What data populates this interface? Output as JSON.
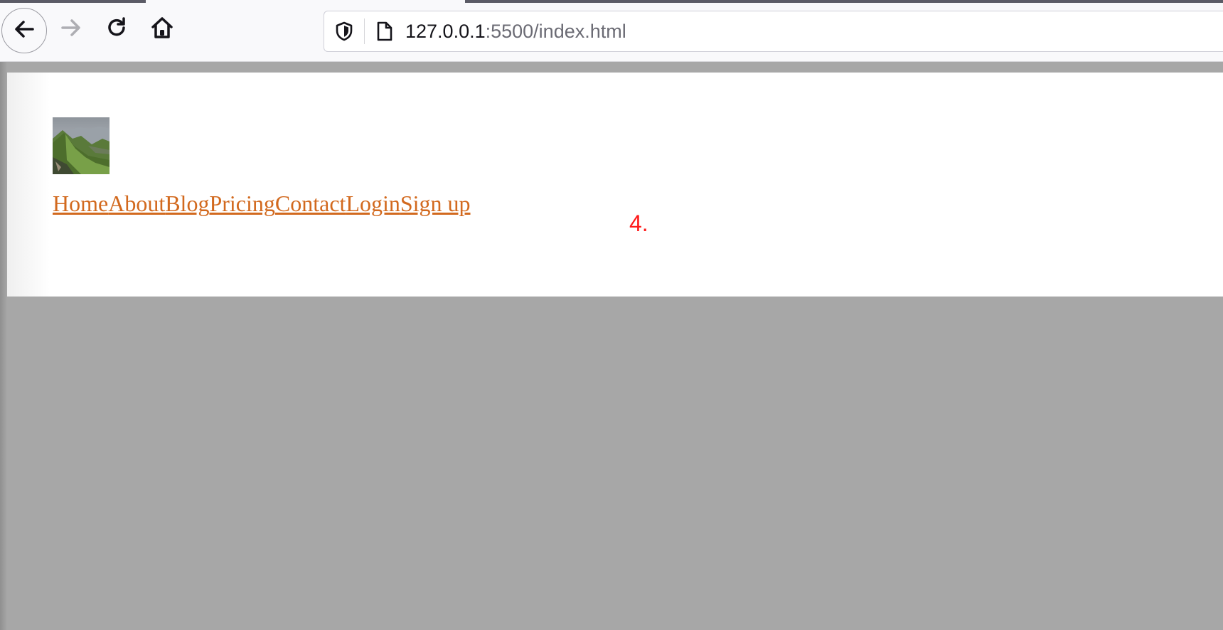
{
  "browser": {
    "url_host": "127.0.0.1",
    "url_rest": ":5500/index.html"
  },
  "page": {
    "nav_links": [
      "Home",
      "About",
      "Blog",
      "Pricing",
      "Contact",
      "Login",
      "Sign up"
    ],
    "marker_text": "4.",
    "link_color": "#d2691e",
    "marker_color": "#ff1a1a"
  },
  "icons": {
    "back": "back-arrow-icon",
    "forward": "forward-arrow-icon",
    "reload": "reload-icon",
    "home": "home-icon",
    "shield": "shield-icon",
    "page": "page-icon",
    "logo": "landscape-logo-image"
  }
}
